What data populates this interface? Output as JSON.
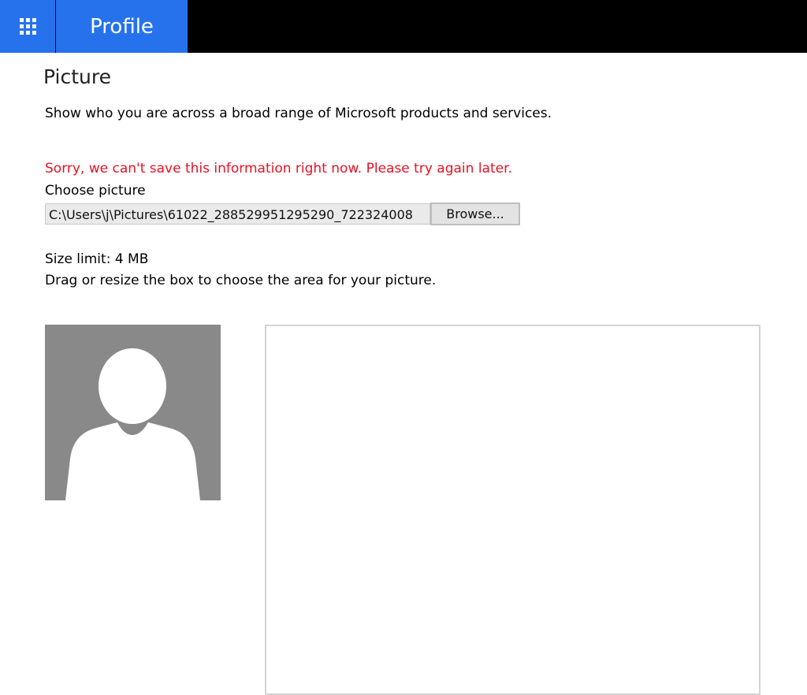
{
  "header": {
    "app_launcher_icon": "waffle-grid-icon",
    "brand_label": "Profile",
    "accent_color": "#2672ec"
  },
  "main": {
    "title": "Picture",
    "description": "Show who you are across a broad range of Microsoft products and services.",
    "error_message": "Sorry, we can't save this information right now. Please try again later.",
    "error_color": "#e81123",
    "choose_label": "Choose picture",
    "file_path": "C:\\Users\\j\\Pictures\\61022_288529951295290_722324008",
    "browse_label": "Browse...",
    "size_limit": "Size limit: 4 MB",
    "instructions": "Drag or resize the box to choose the area for your picture."
  },
  "avatar": {
    "icon": "default-person-icon",
    "background_color": "#898989"
  }
}
